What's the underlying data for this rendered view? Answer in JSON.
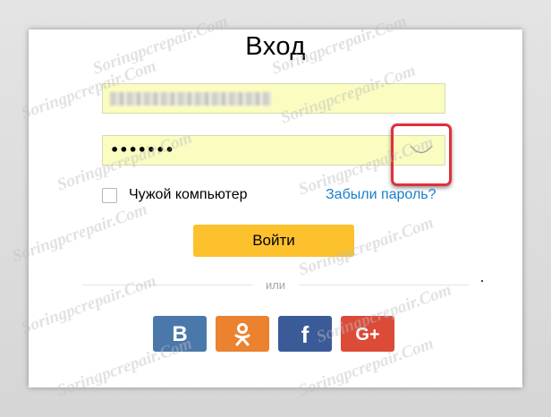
{
  "form": {
    "title": "Вход",
    "password_mask": "•••••••",
    "remember_label": "Чужой компьютер",
    "forgot_link": "Забыли пароль?",
    "submit_label": "Войти",
    "divider_text": "или"
  },
  "social": {
    "vk_label": "В",
    "ok_icon": "odnoklassniki-icon",
    "fb_label": "f",
    "gplus_label": "G+"
  },
  "watermark": "Soringpcrepair.Com",
  "colors": {
    "accent_button": "#fcc12d",
    "link": "#1a7fc9",
    "field_bg": "#fafcc0",
    "highlight": "#e0303b",
    "vk": "#4b78ab",
    "ok": "#ea8230",
    "facebook": "#3b5a98",
    "google_plus": "#dc4a38"
  }
}
